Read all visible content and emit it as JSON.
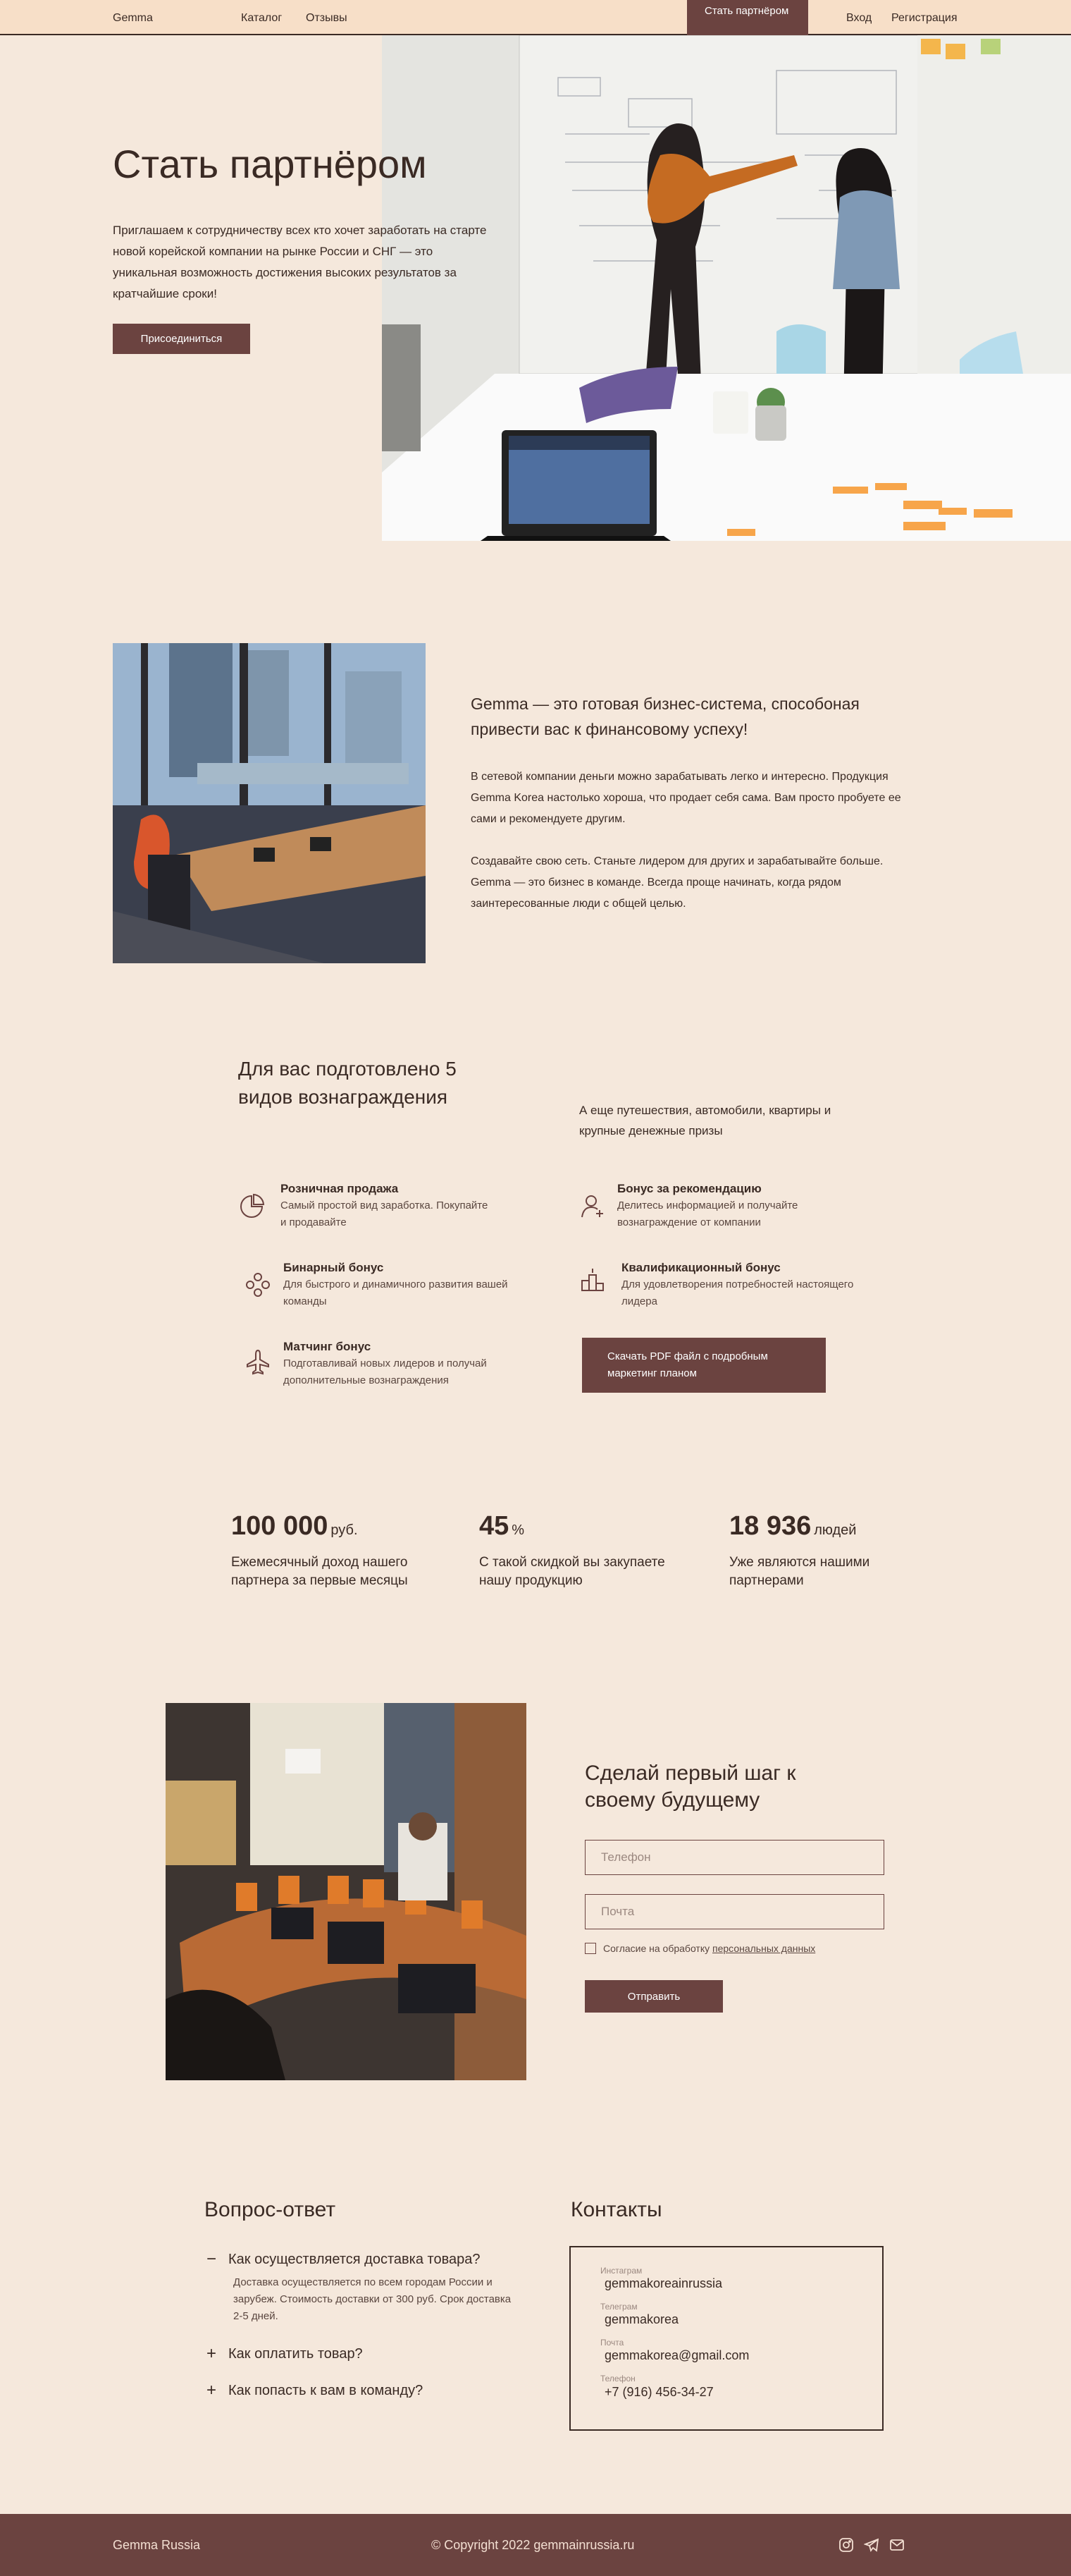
{
  "nav": {
    "logo": "Gemma",
    "links": [
      "Каталог",
      "Отзывы"
    ],
    "cta": "Стать партнёром",
    "login": "Вход",
    "register": "Регистрация"
  },
  "hero": {
    "title": "Стать партнёром",
    "text": "Приглашаем к сотрудничеству всех кто хочет заработать на старте новой корейской компании на рынке России и СНГ — это уникальная возможность достижения высоких результатов за кратчайшие сроки!",
    "button": "Присоединиться"
  },
  "about": {
    "lead": "Gemma — это  готовая бизнес-система, способоная привести вас к финансовому успеху!",
    "p1": "В сетевой компании деньги можно зарабатывать легко и интересно. Продукция Gemma Korea настолько хороша, что продает себя сама. Вам просто пробуете ее сами и рекомендуете другим.",
    "p2": "Создавайте свою сеть. Станьте лидером для других и зарабатывайте больше. Gemma — это бизнес в команде. Всегда проще начинать, когда рядом заинтересованные люди с общей целью."
  },
  "rewards": {
    "title": "Для вас подготовлено 5 видов вознаграждения",
    "note": "А еще путешествия, автомобили, квартиры и крупные денежные призы",
    "items": [
      {
        "title": "Розничная продажа",
        "desc": "Самый простой вид заработка. Покупайте и продавайте",
        "icon": "pie-chart-icon"
      },
      {
        "title": "Бонус за рекомендацию",
        "desc": "Делитесь информацией и получайте вознаграждение от компании",
        "icon": "user-add-icon"
      },
      {
        "title": "Бинарный бонус",
        "desc": "Для быстрого и динамичного развития вашей команды",
        "icon": "team-icon"
      },
      {
        "title": "Квалификационный бонус",
        "desc": "Для удовлетворения потребностей настоящего лидера",
        "icon": "podium-icon"
      },
      {
        "title": "Матчинг бонус",
        "desc": "Подготавливай новых лидеров и получай дополнительные вознаграждения",
        "icon": "airplane-icon"
      }
    ],
    "download_button": "Скачать PDF файл с подробным маркетинг планом"
  },
  "stats": [
    {
      "value": "100 000",
      "unit": "руб.",
      "caption": "Ежемесячный доход нашего партнера за первые месяцы"
    },
    {
      "value": "45",
      "unit": "%",
      "caption": "С такой скидкой вы закупаете нашу продукцию"
    },
    {
      "value": "18 936",
      "unit": "людей",
      "caption": "Уже являются нашими партнерами"
    }
  ],
  "form": {
    "title": "Сделай первый шаг к своему будущему",
    "phone_placeholder": "Телефон",
    "email_placeholder": "Почта",
    "consent_text": "Согласие на обработку",
    "consent_link": "персональных данных",
    "submit": "Отправить"
  },
  "faq": {
    "title": "Вопрос-ответ",
    "items": [
      {
        "q": "Как осуществляется доставка товара?",
        "a": "Доставка осуществляется по всем городам России и зарубеж. Стоимость доставки от 300 руб. Срок доставка 2-5 дней.",
        "open": true
      },
      {
        "q": "Как оплатить товар?",
        "open": false
      },
      {
        "q": "Как попасть к вам в команду?",
        "open": false
      }
    ]
  },
  "contacts": {
    "title": "Контакты",
    "items": [
      {
        "label": "Инстаграм",
        "value": "gemmakoreainrussia"
      },
      {
        "label": "Телеграм",
        "value": "gemmakorea"
      },
      {
        "label": "Почта",
        "value": "gemmakorea@gmail.com"
      },
      {
        "label": "Телефон",
        "value": "+7 (916) 456-34-27"
      }
    ]
  },
  "footer": {
    "brand": "Gemma Russia",
    "copyright": "© Copyright 2022 gemmainrussia.ru",
    "icons": [
      "instagram-icon",
      "telegram-icon",
      "mail-icon"
    ]
  },
  "colors": {
    "background": "#f5e8dc",
    "nav_background": "#f7dfc8",
    "accent": "#6b4340",
    "text": "#3a2a24"
  }
}
